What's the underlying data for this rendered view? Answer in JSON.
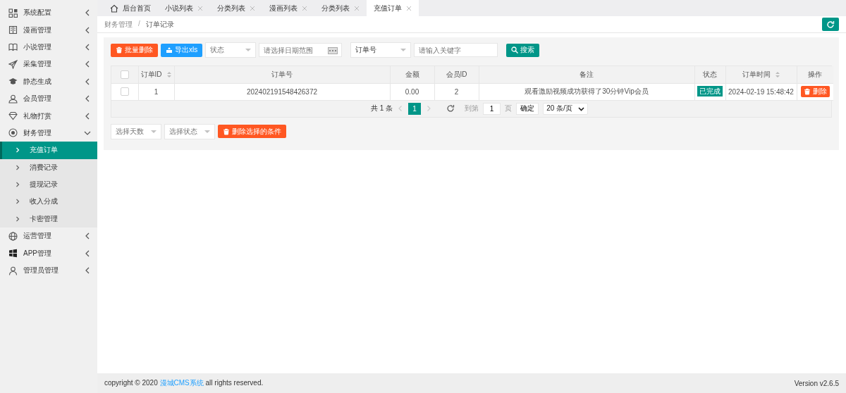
{
  "sidebar": {
    "items": [
      {
        "label": "系统配置",
        "expanded": false
      },
      {
        "label": "漫画管理",
        "expanded": false
      },
      {
        "label": "小说管理",
        "expanded": false
      },
      {
        "label": "采集管理",
        "expanded": false
      },
      {
        "label": "静态生成",
        "expanded": false
      },
      {
        "label": "会员管理",
        "expanded": false
      },
      {
        "label": "礼物打赏",
        "expanded": false
      },
      {
        "label": "财务管理",
        "expanded": true,
        "children": [
          {
            "label": "充值订单",
            "selected": true
          },
          {
            "label": "消费记录",
            "selected": false
          },
          {
            "label": "提现记录",
            "selected": false
          },
          {
            "label": "收入分成",
            "selected": false
          },
          {
            "label": "卡密管理",
            "selected": false
          }
        ]
      },
      {
        "label": "运营管理",
        "expanded": false
      },
      {
        "label": "APP管理",
        "expanded": false
      },
      {
        "label": "管理员管理",
        "expanded": false
      }
    ]
  },
  "tabs": [
    {
      "label": "后台首页",
      "kind": "home",
      "selected": false
    },
    {
      "label": "小说列表",
      "kind": "page",
      "selected": false
    },
    {
      "label": "分类列表",
      "kind": "page",
      "selected": false
    },
    {
      "label": "漫画列表",
      "kind": "page",
      "selected": false
    },
    {
      "label": "分类列表",
      "kind": "page",
      "selected": false
    },
    {
      "label": "充值订单",
      "kind": "page",
      "selected": true
    }
  ],
  "breadcrumb": {
    "items": [
      "财务管理",
      "订单记录"
    ],
    "separator": "/"
  },
  "toolbar": {
    "batch_delete": "批量删除",
    "export": "导出xls",
    "status_select": "状态",
    "date_range": {
      "placeholder": "请选择日期范围"
    },
    "field_select": "订单号",
    "keyword": {
      "placeholder": "请输入关键字"
    },
    "search": "搜索"
  },
  "table": {
    "columns": [
      {
        "label": "订单ID",
        "sortable": true
      },
      {
        "label": "订单号",
        "sortable": false
      },
      {
        "label": "金额",
        "sortable": false
      },
      {
        "label": "会员ID",
        "sortable": false
      },
      {
        "label": "备注",
        "sortable": false
      },
      {
        "label": "状态",
        "sortable": false
      },
      {
        "label": "订单时间",
        "sortable": true
      },
      {
        "label": "操作",
        "sortable": false
      }
    ],
    "header_checked": false,
    "rows": [
      {
        "checked": false,
        "id": "1",
        "order_no": "202402191548426372",
        "amount": "0.00",
        "member_id": "2",
        "note": "观看激励视频成功获得了30分钟Vip会员",
        "status": "已完成",
        "time": "2024-02-19 15:48:42",
        "action": "删除"
      }
    ]
  },
  "pager": {
    "total": "共 1 条",
    "pages": [
      {
        "label": "1",
        "selected": true
      }
    ],
    "goto_label": "到第",
    "goto_value": "1",
    "page_unit": "页",
    "confirm": "确定",
    "page_size": "20 条/页"
  },
  "filters": {
    "days": "选择天数",
    "status": "选择状态",
    "delete": "删除选择的条件"
  },
  "footer": {
    "prefix": "copyright © 2020 ",
    "link": "漫城CMS系统",
    "suffix": " all rights reserved.",
    "version": "Version v2.6.5"
  }
}
